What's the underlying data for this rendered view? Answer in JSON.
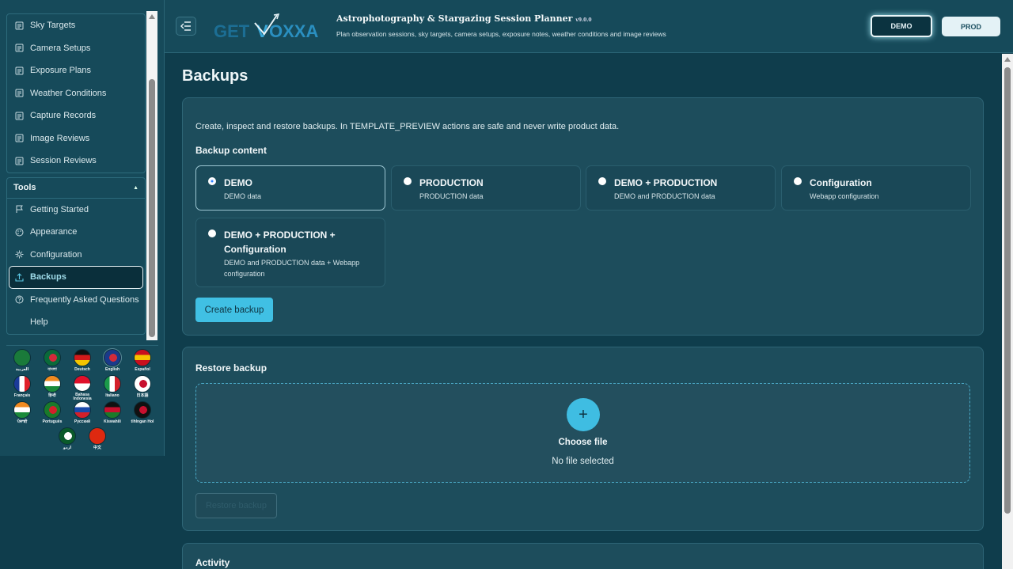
{
  "app": {
    "title": "Astrophotography & Stargazing Session Planner",
    "version": "v9.0.0",
    "subtitle": "Plan observation sessions, sky targets, camera setups, exposure notes, weather conditions and image reviews",
    "logo_text": "GETVOXXA"
  },
  "mode": {
    "demo_label": "DEMO",
    "prod_label": "PROD",
    "active": "DEMO"
  },
  "sidebar": {
    "items": [
      {
        "label": "Sky Targets",
        "icon": "list-icon"
      },
      {
        "label": "Camera Setups",
        "icon": "list-icon"
      },
      {
        "label": "Exposure Plans",
        "icon": "list-icon"
      },
      {
        "label": "Weather Conditions",
        "icon": "list-icon"
      },
      {
        "label": "Capture Records",
        "icon": "list-icon"
      },
      {
        "label": "Image Reviews",
        "icon": "list-icon"
      },
      {
        "label": "Session Reviews",
        "icon": "list-icon"
      }
    ],
    "tools_title": "Tools",
    "tools": [
      {
        "label": "Getting Started",
        "icon": "flag-icon"
      },
      {
        "label": "Appearance",
        "icon": "palette-icon"
      },
      {
        "label": "Configuration",
        "icon": "gear-icon"
      },
      {
        "label": "Backups",
        "icon": "upload-icon"
      },
      {
        "label": "Frequently Asked Questions",
        "icon": "question-icon"
      },
      {
        "label": "Help",
        "icon": ""
      }
    ],
    "active": "Backups"
  },
  "languages": [
    {
      "label": "العربية",
      "colors": [
        "#1a7a3a",
        "#1a7a3a"
      ]
    },
    {
      "label": "বাংলা",
      "colors": [
        "#0a6a3a",
        "#d42a3a"
      ]
    },
    {
      "label": "Deutsch",
      "colors": [
        "#111111",
        "#d41a1a",
        "#f4c400"
      ]
    },
    {
      "label": "English",
      "colors": [
        "#1a3a8a",
        "#d42a3a"
      ]
    },
    {
      "label": "Español",
      "colors": [
        "#c8101e",
        "#f6c400",
        "#c8101e"
      ]
    },
    {
      "label": "Français",
      "colors": [
        "#1a3a9a",
        "#ffffff",
        "#e0202a"
      ]
    },
    {
      "label": "हिन्दी",
      "colors": [
        "#f08a20",
        "#ffffff",
        "#1a8a3a"
      ]
    },
    {
      "label": "Bahasa Indonesia",
      "colors": [
        "#e0102a",
        "#ffffff"
      ]
    },
    {
      "label": "Italiano",
      "colors": [
        "#1a9a4a",
        "#ffffff",
        "#d4202a"
      ]
    },
    {
      "label": "日本語",
      "colors": [
        "#ffffff",
        "#c8102e"
      ]
    },
    {
      "label": "ਪੰਜਾਬੀ",
      "colors": [
        "#f08a20",
        "#ffffff",
        "#1a8a3a"
      ]
    },
    {
      "label": "Português",
      "colors": [
        "#1a7a2a",
        "#d4202a"
      ]
    },
    {
      "label": "Русский",
      "colors": [
        "#ffffff",
        "#1a4aaa",
        "#d4202a"
      ]
    },
    {
      "label": "Kiswahili",
      "colors": [
        "#111111",
        "#c8102e",
        "#1a7a2a"
      ]
    },
    {
      "label": "tlhIngan Hol",
      "colors": [
        "#111111",
        "#c8102e"
      ]
    },
    {
      "label": "اردو",
      "colors": [
        "#0a5a2a",
        "#ffffff"
      ]
    },
    {
      "label": "中文",
      "colors": [
        "#de2910",
        "#de2910"
      ]
    }
  ],
  "page": {
    "title": "Backups",
    "intro": "Create, inspect and restore backups. In TEMPLATE_PREVIEW actions are safe and never write product data.",
    "content_title": "Backup content",
    "options": [
      {
        "title": "DEMO",
        "desc": "DEMO data",
        "selected": true
      },
      {
        "title": "PRODUCTION",
        "desc": "PRODUCTION data",
        "selected": false
      },
      {
        "title": "DEMO + PRODUCTION",
        "desc": "DEMO and PRODUCTION data",
        "selected": false
      },
      {
        "title": "Configuration",
        "desc": "Webapp configuration",
        "selected": false
      },
      {
        "title": "DEMO + PRODUCTION + Configuration",
        "desc": "DEMO and PRODUCTION data + Webapp configuration",
        "selected": false
      }
    ],
    "create_button": "Create backup",
    "restore_title": "Restore backup",
    "choose_file": "Choose file",
    "no_file": "No file selected",
    "restore_button": "Restore backup",
    "activity_title": "Activity"
  },
  "colors": {
    "accent": "#40c0e4",
    "background": "#0f3d4c",
    "card": "#1d4d5c"
  }
}
